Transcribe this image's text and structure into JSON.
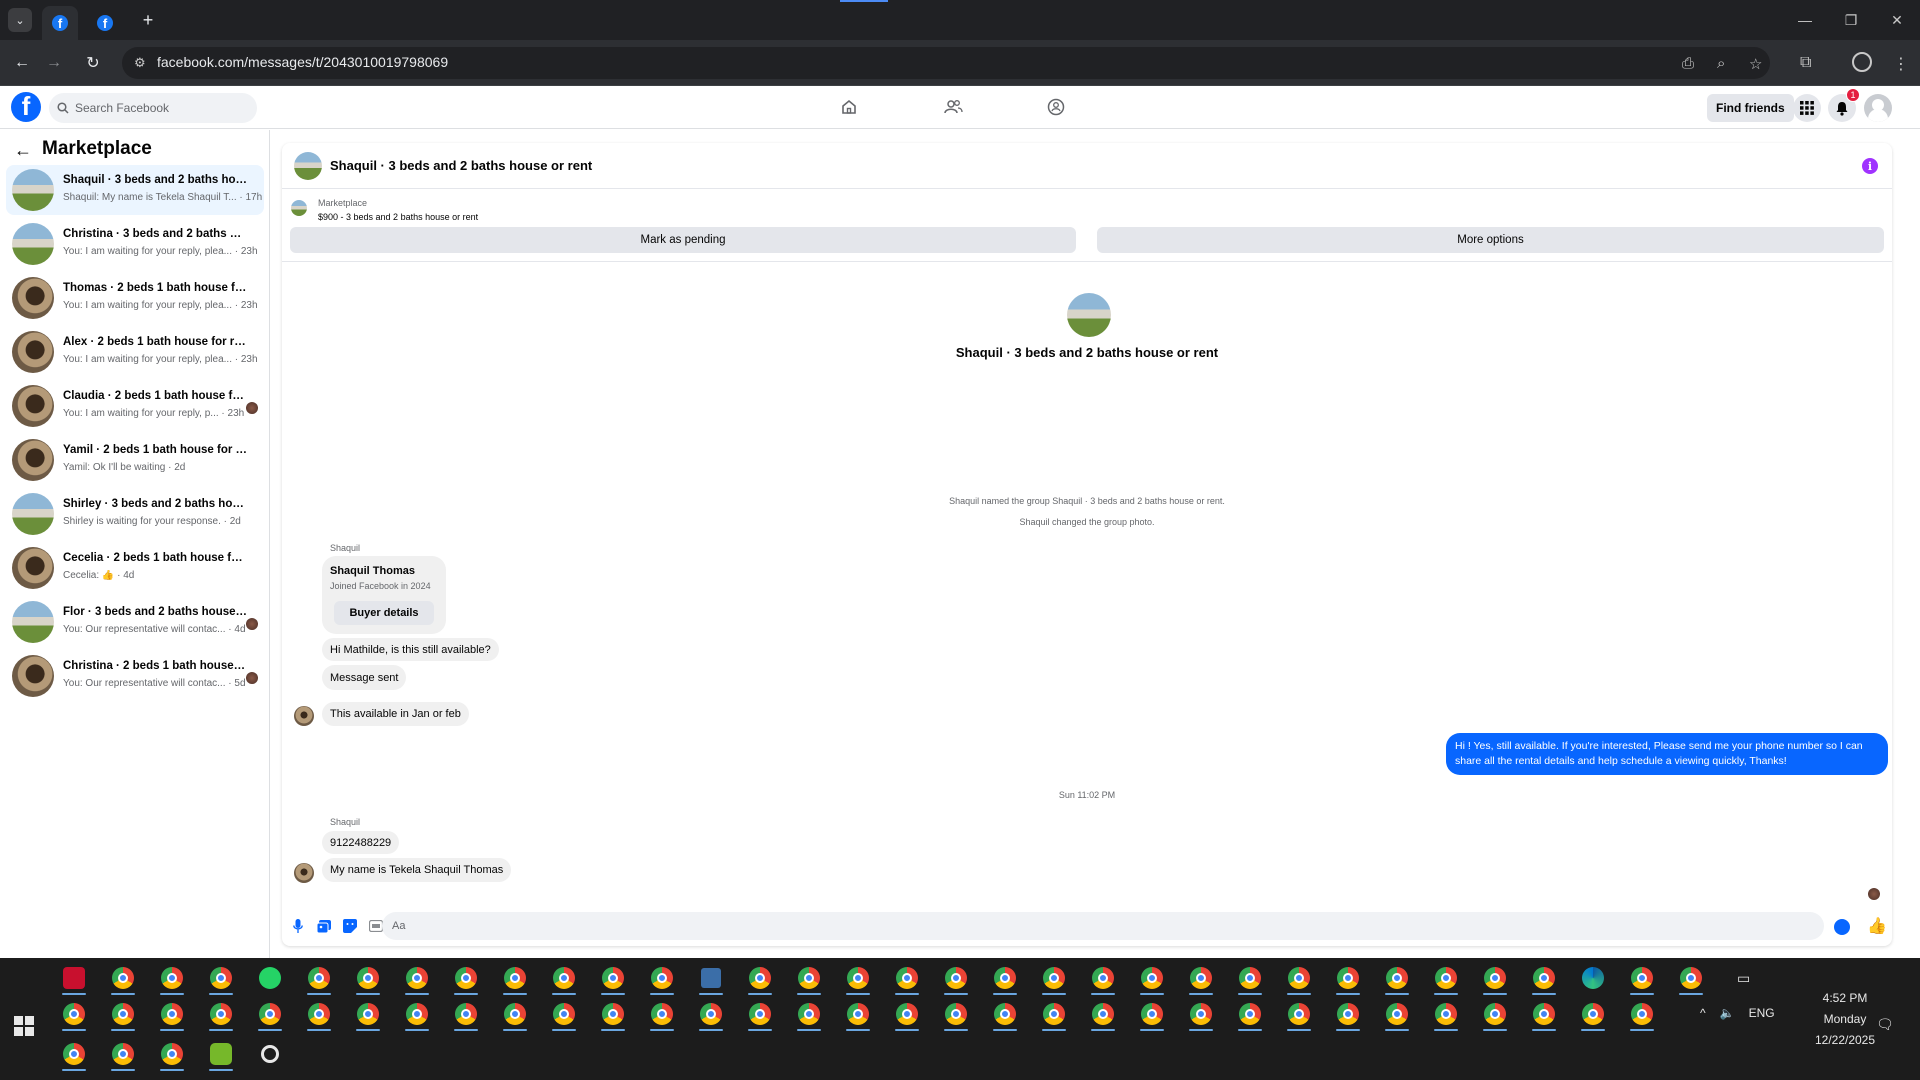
{
  "browser": {
    "url": "facebook.com/messages/t/2043010019798069",
    "new_tab": "+",
    "win_min": "—",
    "win_restore": "❐",
    "win_close": "✕"
  },
  "fb": {
    "logo": "f",
    "search_placeholder": "Search Facebook",
    "find_friends": "Find friends",
    "notif_count": "1"
  },
  "sidebar": {
    "title": "Marketplace",
    "conversations": [
      {
        "name": "Shaquil · 3 beds and 2 baths house or rent",
        "snippet": "Shaquil: My name is Tekela Shaquil T... · 17h",
        "thumb": "house"
      },
      {
        "name": "Christina · 3 beds and 2 baths house or rent",
        "snippet": "You: I am waiting for your reply, plea... · 23h",
        "thumb": "house"
      },
      {
        "name": "Thomas · 2 beds 1 bath house for rent",
        "snippet": "You: I am waiting for your reply, plea... · 23h",
        "thumb": "cat"
      },
      {
        "name": "Alex · 2 beds 1 bath house for rent",
        "snippet": "You: I am waiting for your reply, plea... · 23h",
        "thumb": "cat"
      },
      {
        "name": "Claudia · 2 beds 1 bath house for rent",
        "snippet": "You: I am waiting for your reply, p... · 23h",
        "thumb": "cat"
      },
      {
        "name": "Yamil · 2 beds 1 bath house for rent",
        "snippet": "Yamil: Ok I'll be waiting · 2d",
        "thumb": "cat"
      },
      {
        "name": "Shirley · 3 beds and 2 baths house or rent",
        "snippet": "Shirley is waiting for your response. · 2d",
        "thumb": "house"
      },
      {
        "name": "Cecelia · 2 beds 1 bath house for rent",
        "snippet": "Cecelia: 👍 · 4d",
        "thumb": "cat"
      },
      {
        "name": "Flor · 3 beds and 2 baths house or rent",
        "snippet": "You: Our representative will contac... · 4d",
        "thumb": "house"
      },
      {
        "name": "Christina · 2 beds 1 bath house for rent",
        "snippet": "You: Our representative will contac... · 5d",
        "thumb": "cat"
      }
    ]
  },
  "chat": {
    "title": "Shaquil · 3 beds and 2 baths house or rent",
    "listing_category": "Marketplace",
    "listing_price": "$900 - 3 beds and 2 baths house or rent",
    "mark_pending": "Mark as pending",
    "more_options": "More options",
    "hero_title": "Shaquil · 3 beds and 2 baths house or rent",
    "sys1": "Shaquil named the group Shaquil · 3 beds and 2 baths house or rent.",
    "sys2": "Shaquil changed the group photo.",
    "sender": "Shaquil",
    "card_name": "Shaquil Thomas",
    "card_sub": "Joined Facebook in 2024",
    "card_button": "Buyer details",
    "msg1": "Hi Mathilde, is this still available?",
    "msg2": "Message sent",
    "msg3": "This available in Jan or feb",
    "my_msg": "Hi ! Yes, still available. If you're interested, Please send me your phone number so I can share all the rental details and help schedule a viewing quickly, Thanks!",
    "time_sep": "Sun 11:02 PM",
    "msg4": "9122488229",
    "msg5": "My name is Tekela Shaquil Thomas",
    "composer_placeholder": "Aa"
  },
  "taskbar": {
    "lang": "ENG",
    "time": "4:52 PM",
    "day": "Monday",
    "date": "12/22/2025"
  },
  "colors": {
    "fb_blue": "#0866ff",
    "active_conv": "#ebf5ff",
    "info_purple": "#a033ff"
  }
}
